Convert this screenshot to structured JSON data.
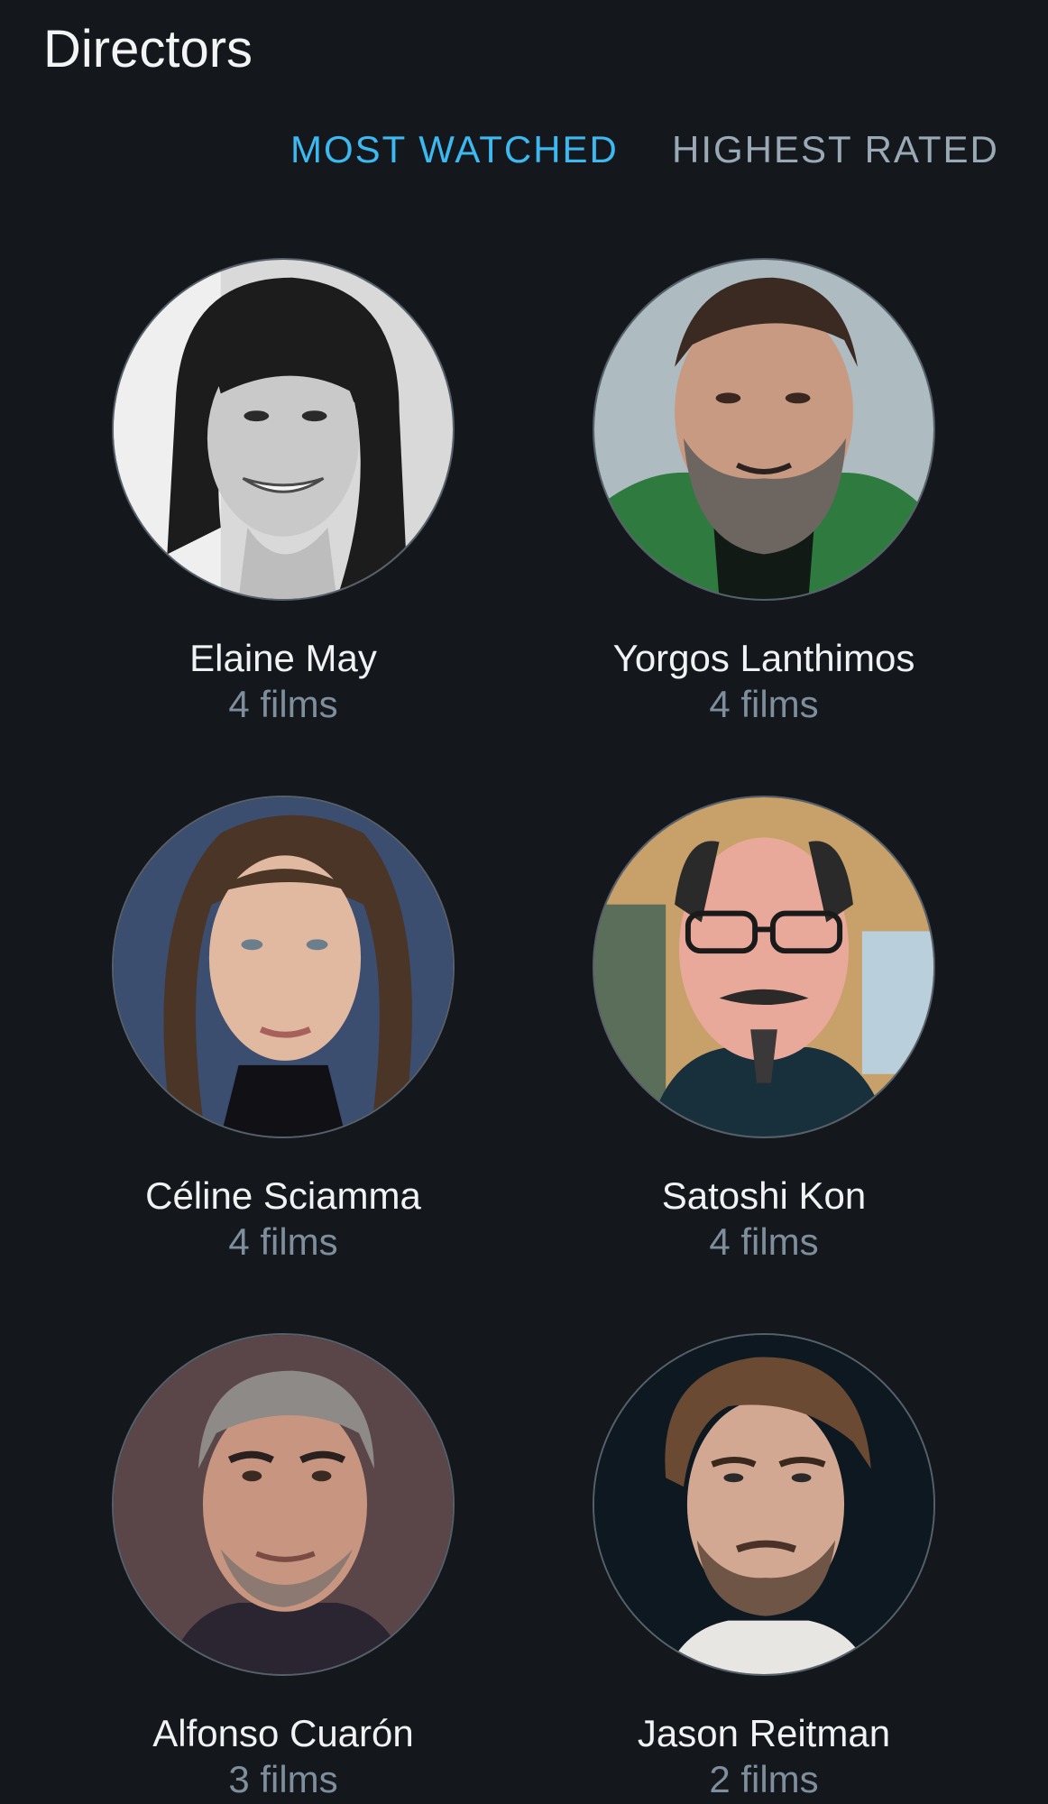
{
  "header": {
    "title": "Directors"
  },
  "tabs": [
    {
      "label": "MOST WATCHED",
      "active": true
    },
    {
      "label": "HIGHEST RATED",
      "active": false
    }
  ],
  "colors": {
    "background": "#14181c",
    "accent": "#3cb9f0",
    "muted": "#7e8e9c"
  },
  "directors": [
    {
      "name": "Elaine May",
      "films": "4 films",
      "avatar_icon": "portrait-photo"
    },
    {
      "name": "Yorgos Lanthimos",
      "films": "4 films",
      "avatar_icon": "portrait-photo"
    },
    {
      "name": "Céline Sciamma",
      "films": "4 films",
      "avatar_icon": "portrait-photo"
    },
    {
      "name": "Satoshi Kon",
      "films": "4 films",
      "avatar_icon": "portrait-photo"
    },
    {
      "name": "Alfonso Cuarón",
      "films": "3 films",
      "avatar_icon": "portrait-photo"
    },
    {
      "name": "Jason Reitman",
      "films": "2 films",
      "avatar_icon": "portrait-photo"
    }
  ]
}
